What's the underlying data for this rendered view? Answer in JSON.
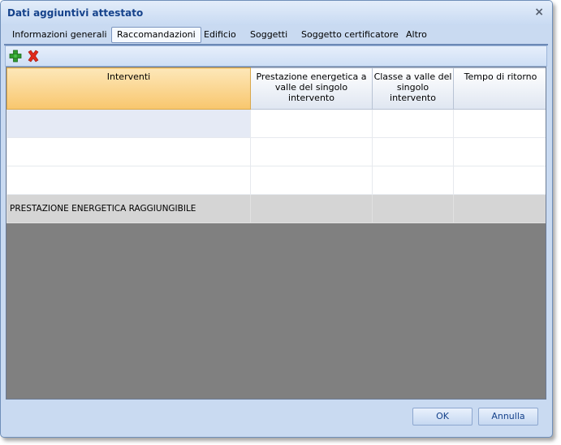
{
  "window": {
    "title": "Dati aggiuntivi attestato",
    "close_glyph": "×"
  },
  "tabs": [
    {
      "label": "Informazioni generali"
    },
    {
      "label": "Raccomandazioni",
      "active": true
    },
    {
      "label": "Edificio"
    },
    {
      "label": "Soggetti"
    },
    {
      "label": "Soggetto certificatore"
    },
    {
      "label": "Altro"
    }
  ],
  "toolbar": {
    "add_icon": "plus-icon",
    "delete_icon": "delete-x-icon"
  },
  "grid": {
    "columns": [
      "Interventi",
      "Prestazione energetica a valle del singolo intervento",
      "Classe a valle del singolo intervento",
      "Tempo di ritorno"
    ],
    "rows": [
      [
        "",
        "",
        "",
        ""
      ],
      [
        "",
        "",
        "",
        ""
      ],
      [
        "",
        "",
        "",
        ""
      ]
    ],
    "summary_row": [
      "PRESTAZIONE ENERGETICA RAGGIUNGIBILE",
      "",
      "",
      ""
    ]
  },
  "buttons": {
    "ok": "OK",
    "cancel": "Annulla"
  },
  "colors": {
    "accent_title": "#15428b",
    "selected_header": "#f8c66d",
    "grid_empty_area": "#808080"
  }
}
